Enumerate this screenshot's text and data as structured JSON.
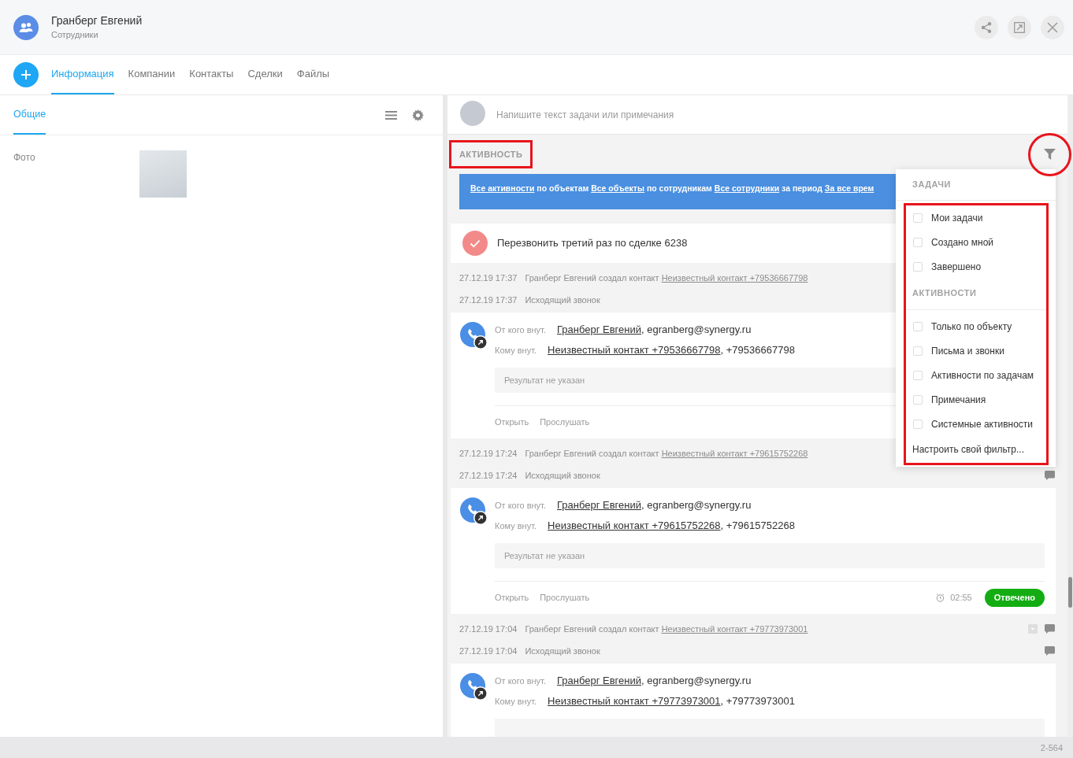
{
  "header": {
    "title": "Гранберг Евгений",
    "subtitle": "Сотрудники",
    "actions": [
      {
        "kind": "share"
      },
      {
        "kind": "external"
      },
      {
        "kind": "close"
      }
    ]
  },
  "tabs": [
    {
      "label": "Информация",
      "selected": true
    },
    {
      "label": "Компании",
      "selected": false
    },
    {
      "label": "Контакты",
      "selected": false
    },
    {
      "label": "Сделки",
      "selected": false
    },
    {
      "label": "Файлы",
      "selected": false
    }
  ],
  "left_panel": {
    "subtabs": [
      {
        "label": "Общие",
        "selected": true
      }
    ],
    "fields": [
      {
        "label": "Фото",
        "kind": "photo"
      }
    ]
  },
  "composer": {
    "placeholder": "Напишите текст задачи или примечания"
  },
  "activity": {
    "title": "АКТИВНОСТЬ",
    "title_highlighted": true,
    "filter_highlighted": true,
    "banner": [
      {
        "kind": "link",
        "text": "Все активности"
      },
      {
        "kind": "text",
        "text": "по объектам"
      },
      {
        "kind": "link",
        "text": "Все объекты"
      },
      {
        "kind": "text",
        "text": "по сотрудникам"
      },
      {
        "kind": "link",
        "text": "Все сотрудники"
      },
      {
        "kind": "text",
        "text": "за период"
      },
      {
        "kind": "link",
        "text": "За все врем"
      }
    ],
    "timeline": [
      {
        "kind": "task",
        "title": "Перезвонить третий раз по сделке 6238"
      },
      {
        "kind": "event",
        "date": "27.12.19 17:37",
        "text": "Гранберг Евгений создал контакт",
        "link": "Неизвестный контакт +79536667798"
      },
      {
        "kind": "event",
        "date": "27.12.19 17:37",
        "text": "Исходящий звонок"
      },
      {
        "kind": "call",
        "from_label": "От кого внут.",
        "from_link": "Гранберг Евгений",
        "from_rest": ", egranberg@synergy.ru",
        "to_label": "Кому внут.",
        "to_link": "Неизвестный контакт +79536667798",
        "to_rest": ", +79536667798",
        "result": "Результат не указан",
        "actions": [
          "Открыть",
          "Прослушать"
        ]
      },
      {
        "kind": "event",
        "date": "27.12.19 17:24",
        "text": "Гранберг Евгений создал контакт",
        "link": "Неизвестный контакт +79615752268"
      },
      {
        "kind": "event",
        "date": "27.12.19 17:24",
        "text": "Исходящий звонок",
        "buttons": [
          {
            "kind": "comment"
          }
        ]
      },
      {
        "kind": "call",
        "from_label": "От кого внут.",
        "from_link": "Гранберг Евгений",
        "from_rest": ", egranberg@synergy.ru",
        "to_label": "Кому внут.",
        "to_link": "Неизвестный контакт +79615752268",
        "to_rest": ", +79615752268",
        "result": "Результат не указан",
        "actions": [
          "Открыть",
          "Прослушать"
        ],
        "duration": "02:55",
        "status": {
          "label": "Отвечено",
          "kind": "answered"
        }
      },
      {
        "kind": "event",
        "date": "27.12.19 17:04",
        "text": "Гранберг Евгений создал контакт",
        "link": "Неизвестный контакт +79773973001",
        "buttons": [
          {
            "kind": "collapse"
          },
          {
            "kind": "comment"
          }
        ]
      },
      {
        "kind": "event",
        "date": "27.12.19 17:04",
        "text": "Исходящий звонок",
        "buttons": [
          {
            "kind": "comment"
          }
        ]
      },
      {
        "kind": "call",
        "from_label": "От кого внут.",
        "from_link": "Гранберг Евгений",
        "from_rest": ", egranberg@synergy.ru",
        "to_label": "Кому внут.",
        "to_link": "Неизвестный контакт +79773973001",
        "to_rest": ", +79773973001"
      }
    ]
  },
  "filter_menu": {
    "highlighted": true,
    "sections": [
      {
        "title": "ЗАДАЧИ",
        "options": [
          {
            "label": "Мои задачи",
            "checked": false
          },
          {
            "label": "Создано мной",
            "checked": false
          },
          {
            "label": "Завершено",
            "checked": false
          }
        ]
      },
      {
        "title": "АКТИВНОСТИ",
        "options": [
          {
            "label": "Только по объекту",
            "checked": false
          },
          {
            "label": "Письма и звонки",
            "checked": false
          },
          {
            "label": "Активности по задачам",
            "checked": false
          },
          {
            "label": "Примечания",
            "checked": false
          },
          {
            "label": "Системные активности",
            "checked": false
          }
        ]
      }
    ],
    "custom_filter": "Настроить свой фильтр..."
  },
  "footer": {
    "text": "2-564"
  }
}
